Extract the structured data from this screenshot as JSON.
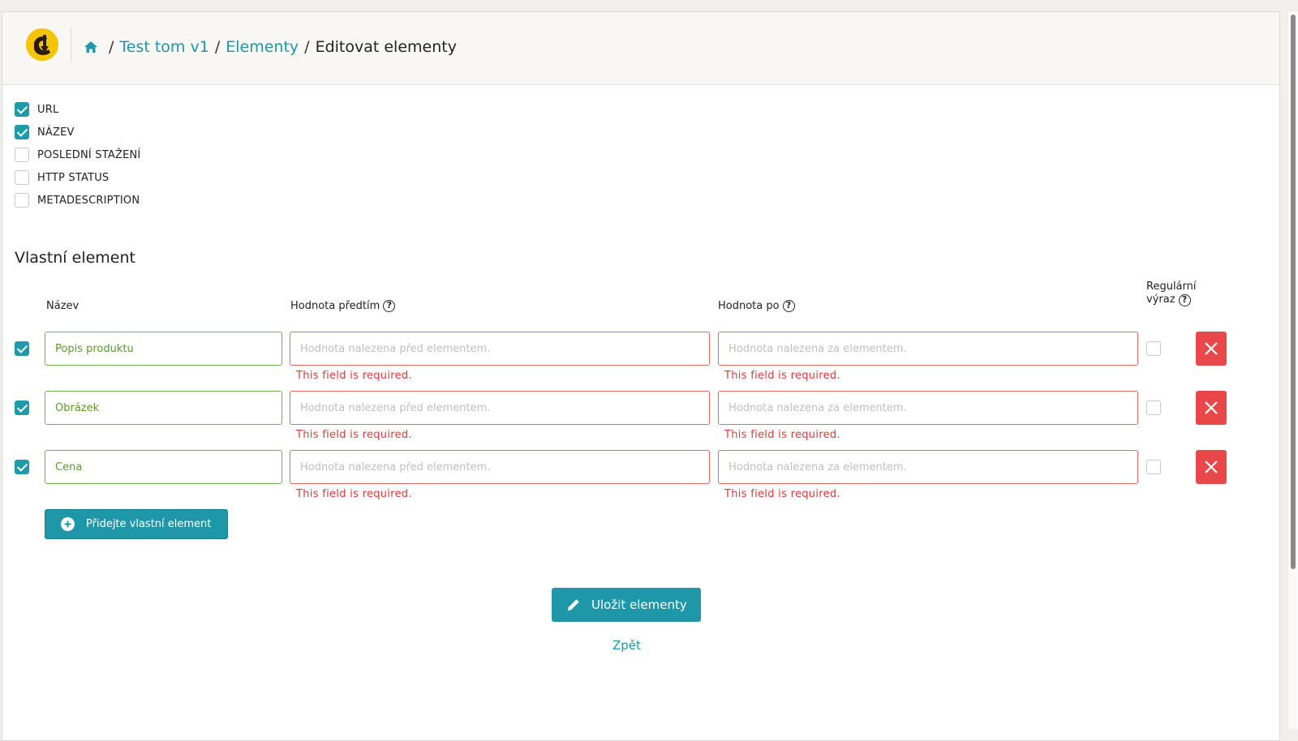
{
  "breadcrumb": {
    "home_icon": "home-icon",
    "items": [
      "Test tom v1",
      "Elementy"
    ],
    "current": "Editovat elementy",
    "separator": "/"
  },
  "columns_options": [
    {
      "label": "URL",
      "checked": true
    },
    {
      "label": "NÁZEV",
      "checked": true
    },
    {
      "label": "POSLEDNÍ STAŽENÍ",
      "checked": false
    },
    {
      "label": "HTTP STATUS",
      "checked": false
    },
    {
      "label": "METADESCRIPTION",
      "checked": false
    }
  ],
  "custom": {
    "title": "Vlastní element",
    "headers": {
      "name": "Název",
      "before": "Hodnota předtím",
      "after": "Hodnota po",
      "regex_line1": "Regulární",
      "regex_line2": "výraz",
      "help": "?"
    },
    "rows": [
      {
        "checked": true,
        "name": "Popis produktu",
        "before": "",
        "after": "",
        "regex": false
      },
      {
        "checked": true,
        "name": "Obrázek",
        "before": "",
        "after": "",
        "regex": false
      },
      {
        "checked": true,
        "name": "Cena",
        "before": "",
        "after": "",
        "regex": false
      }
    ],
    "before_placeholder": "Hodnota nalezena před elementem.",
    "after_placeholder": "Hodnota nalezena za elementem.",
    "error": "This field is required.",
    "add_label": "Přidejte vlastní element"
  },
  "actions": {
    "save_label": "Uložit elementy",
    "back_label": "Zpět"
  },
  "colors": {
    "accent": "#1e97a9",
    "danger": "#e8484a",
    "valid": "#7bb24a",
    "error_text": "#e03a3a",
    "logo": "#f5c400"
  }
}
